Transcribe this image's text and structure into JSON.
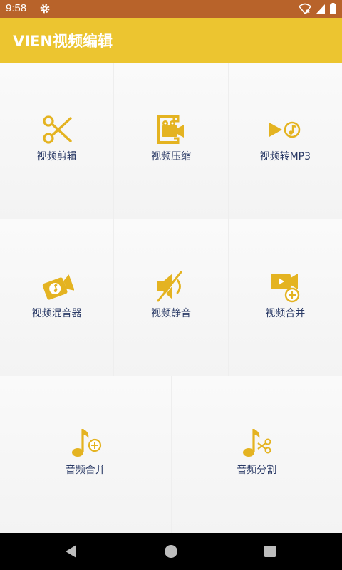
{
  "status_bar": {
    "time": "9:58"
  },
  "app_bar": {
    "title": "VIEN视频编辑"
  },
  "tools": {
    "video_cut": "视频剪辑",
    "video_compress": "视频压缩",
    "video_to_mp3": "视频转MP3",
    "video_mix_audio": "视频混音器",
    "video_mute": "视频静音",
    "video_merge": "视频合并",
    "audio_merge": "音频合并",
    "audio_split": "音频分割"
  },
  "colors": {
    "accent": "#ecc530",
    "icon": "#e4b321",
    "status": "#b8632a",
    "label": "#2a3a66"
  }
}
